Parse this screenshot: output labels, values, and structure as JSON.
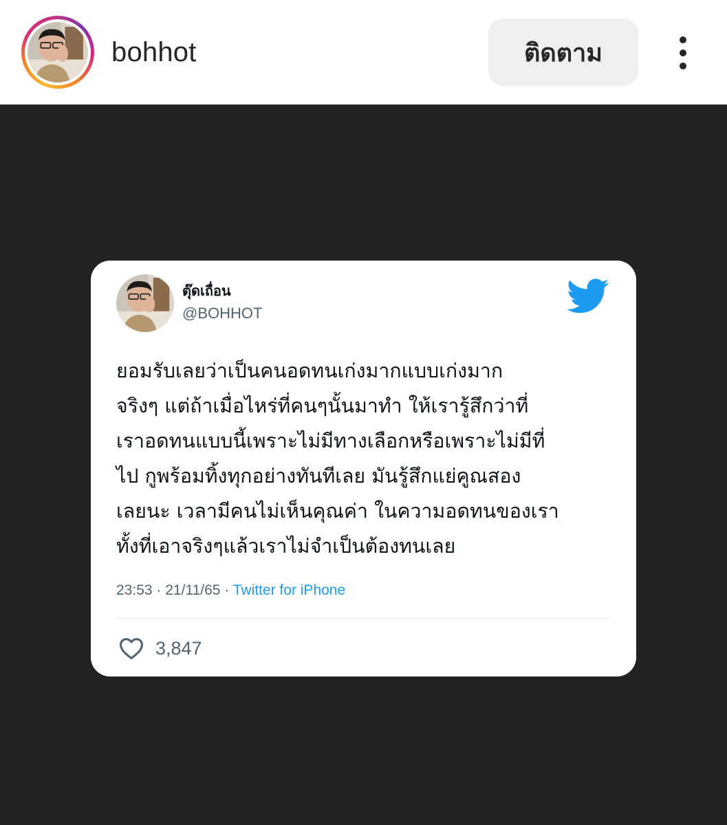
{
  "header": {
    "username": "bohhot",
    "follow_label": "ติดตาม",
    "avatar_icon": "profile-avatar",
    "more_icon": "more-vertical-icon"
  },
  "tweet": {
    "display_name": "ตุ๊ดเถื่อน",
    "handle": "@BOHHOT",
    "brand_icon": "twitter-bird-icon",
    "brand_color": "#1d9bf0",
    "text_lines": [
      "ยอมรับเลยว่าเป็นคนอดทนเก่งมากแบบเก่งมาก",
      "จริงๆ แต่ถ้าเมื่อไหร่ที่คนๆนั้นมาทำ ให้เรารู้สึกว่าที่",
      "เราอดทนแบบนี้เพราะไม่มีทางเลือกหรือเพราะไม่มีที่",
      "ไป กูพร้อมทิ้งทุกอย่างทันทีเลย มันรู้สึกแย่คูณสอง",
      "เลยนะ เวลามีคนไม่เห็นคุณค่า ในความอดทนของเรา",
      "ทั้งที่เอาจริงๆแล้วเราไม่จำเป็นต้องทนเลย"
    ],
    "time": "23:53",
    "date": "21/11/65",
    "separator": "·",
    "source": "Twitter for iPhone",
    "likes": "3,847",
    "like_icon": "heart-outline-icon"
  },
  "colors": {
    "post_background": "#222222",
    "follow_button_bg": "#efefef",
    "meta_gray": "#536471"
  }
}
